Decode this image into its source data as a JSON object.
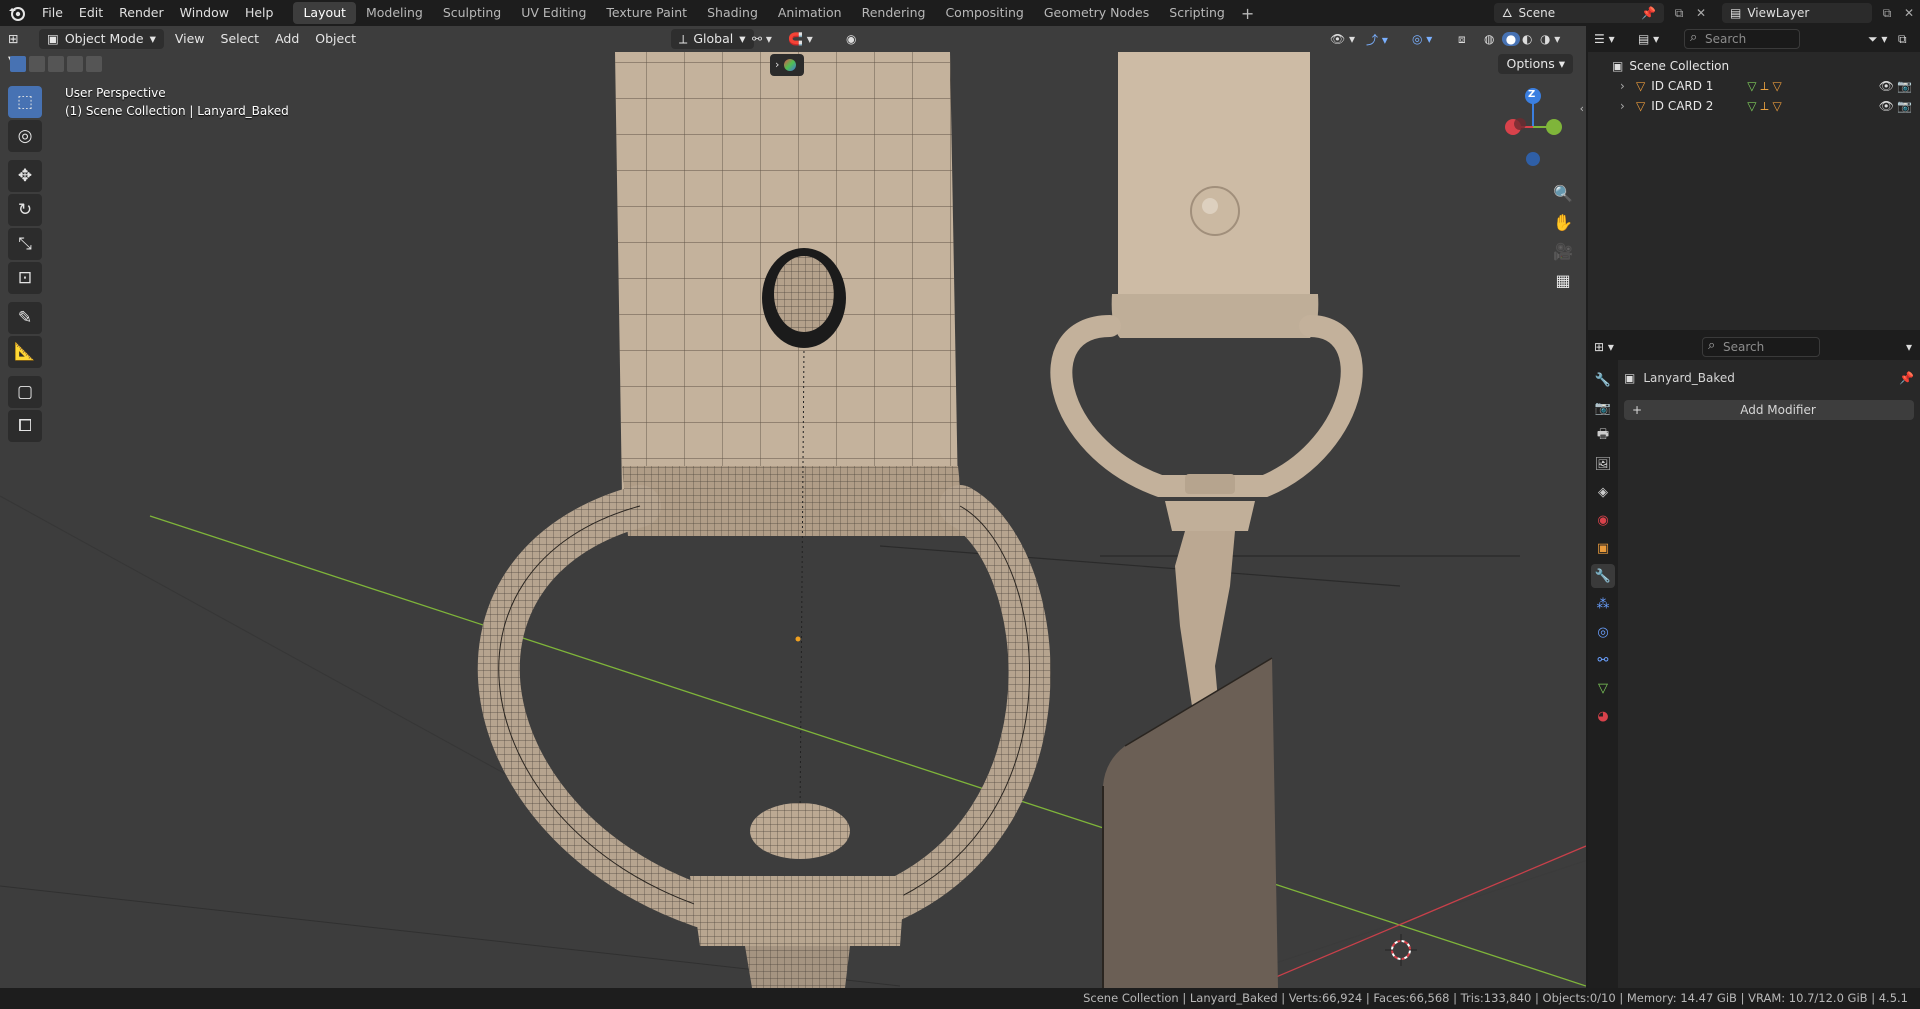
{
  "menu": {
    "items": [
      "File",
      "Edit",
      "Render",
      "Window",
      "Help"
    ]
  },
  "workspaces": {
    "tabs": [
      "Layout",
      "Modeling",
      "Sculpting",
      "UV Editing",
      "Texture Paint",
      "Shading",
      "Animation",
      "Rendering",
      "Compositing",
      "Geometry Nodes",
      "Scripting"
    ],
    "active": "Layout"
  },
  "scene": {
    "name": "Scene"
  },
  "view_layer": {
    "name": "ViewLayer"
  },
  "viewport": {
    "mode": "Object Mode",
    "menus": [
      "View",
      "Select",
      "Add",
      "Object"
    ],
    "orientation": "Global",
    "options_label": "Options",
    "perspective_label": "User Perspective",
    "context_label": "(1) Scene Collection | Lanyard_Baked",
    "gizmo_z": "Z"
  },
  "outliner": {
    "search_placeholder": "Search",
    "root": "Scene Collection",
    "items": [
      {
        "name": "ID CARD 1"
      },
      {
        "name": "ID CARD 2"
      }
    ]
  },
  "properties": {
    "search_placeholder": "Search",
    "object_name": "Lanyard_Baked",
    "add_modifier_label": "Add Modifier"
  },
  "status": {
    "text": "Scene Collection | Lanyard_Baked | Verts:66,924 | Faces:66,568 | Tris:133,840 | Objects:0/10 | Memory: 14.47 GiB | VRAM: 10.7/12.0 GiB | 4.5.1"
  },
  "colors": {
    "accent": "#4772b3",
    "viewport_bg": "#3d3d3d",
    "mesh": "#b9a792",
    "x_axis": "#d8424b",
    "y_axis": "#7fb53a",
    "z_axis": "#3b7fe0"
  }
}
